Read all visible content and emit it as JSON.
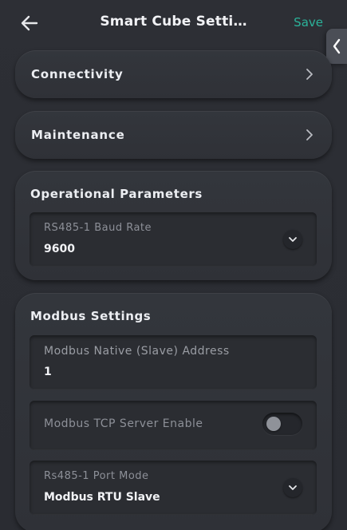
{
  "header": {
    "title": "Smart Cube Setti…",
    "save_label": "Save"
  },
  "nav": [
    {
      "label": "Connectivity"
    },
    {
      "label": "Maintenance"
    }
  ],
  "operational": {
    "title": "Operational Parameters",
    "baud_rate": {
      "label": "RS485-1 Baud Rate",
      "value": "9600"
    }
  },
  "modbus": {
    "title": "Modbus Settings",
    "address": {
      "label": "Modbus Native (Slave) Address",
      "value": "1"
    },
    "tcp_server": {
      "label": "Modbus TCP Server Enable",
      "enabled": false
    },
    "port_mode": {
      "label": "Rs485-1 Port Mode",
      "value": "Modbus RTU Slave"
    }
  },
  "colors": {
    "accent": "#2bb39a",
    "background": "#2b2d33",
    "card": "#33363c"
  }
}
